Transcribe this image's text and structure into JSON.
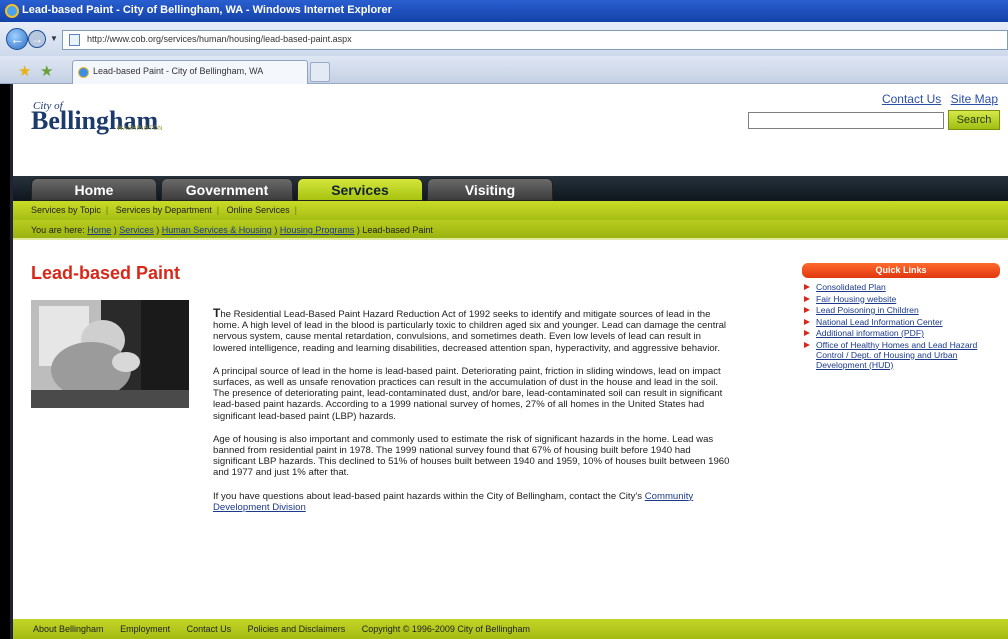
{
  "window": {
    "title": "Lead-based Paint - City of Bellingham, WA - Windows Internet Explorer",
    "url": "http://www.cob.org/services/human/housing/lead-based-paint.aspx",
    "tab_label": "Lead-based Paint - City of Bellingham, WA"
  },
  "header": {
    "logo_small": "City of",
    "logo_big": "Bellingham",
    "logo_sub": "WASHINGTON",
    "links": [
      "Contact Us",
      "Site Map"
    ],
    "search_button": "Search"
  },
  "mainnav": {
    "tabs": [
      "Home",
      "Government",
      "Services",
      "Visiting"
    ],
    "active": "Services"
  },
  "subnav": {
    "items": [
      "Services by Topic",
      "Services by Department",
      "Online Services"
    ]
  },
  "breadcrumb": {
    "prefix": "You are here:",
    "items": [
      "Home",
      "Services",
      "Human Services & Housing",
      "Housing Programs"
    ],
    "current": "Lead-based Paint"
  },
  "main": {
    "title": "Lead-based Paint",
    "para1_first": "T",
    "para1_rest": "he Residential Lead-Based Paint Hazard Reduction Act of 1992 seeks to identify and mitigate sources of lead in the home. A high level of lead in the blood is particularly toxic to children aged six and younger. Lead can damage the central nervous system, cause mental retardation, convulsions, and sometimes death. Even low levels of lead can result in lowered intelligence, reading and learning disabilities, decreased attention span, hyperactivity, and aggressive behavior.",
    "para2": "A principal source of lead in the home is lead-based paint. Deteriorating paint, friction in sliding windows, lead on impact surfaces, as well as unsafe renovation practices can result in the accumulation of dust in the house and lead in the soil. The presence of deteriorating paint, lead-contaminated dust, and/or bare, lead-contaminated soil can result in significant lead-based paint hazards. According to a 1999 national survey of homes, 27% of all homes in the United States had significant lead-based paint (LBP) hazards.",
    "para3": "Age of housing is also important and commonly used to estimate the risk of significant hazards in the home. Lead was banned from residential paint in 1978. The 1999 national survey found that 67% of housing built before 1940 had significant LBP hazards. This declined to 51% of houses built between 1940 and 1959, 10% of houses built between 1960 and 1977 and just 1% after that.",
    "para4_text": "If you have questions about lead-based paint hazards within the City of Bellingham, contact the City's",
    "para4_link": "Community Development Division"
  },
  "quicklinks": {
    "title": "Quick Links",
    "items": [
      "Consolidated Plan",
      "Fair Housing website",
      "Lead Poisoning in Children",
      "National Lead Information Center",
      "Additional information (PDF)",
      "Office of Healthy Homes and Lead Hazard Control / Dept. of Housing and Urban Development (HUD)"
    ]
  },
  "footer": {
    "items": [
      "About Bellingham",
      "Employment",
      "Contact Us",
      "Policies and Disclaimers",
      "Copyright © 1996-2009 City of Bellingham"
    ]
  },
  "colors": {
    "accent_green": "#b8cd1d",
    "title_red": "#d8281a",
    "link_blue": "#1c3a8a"
  }
}
